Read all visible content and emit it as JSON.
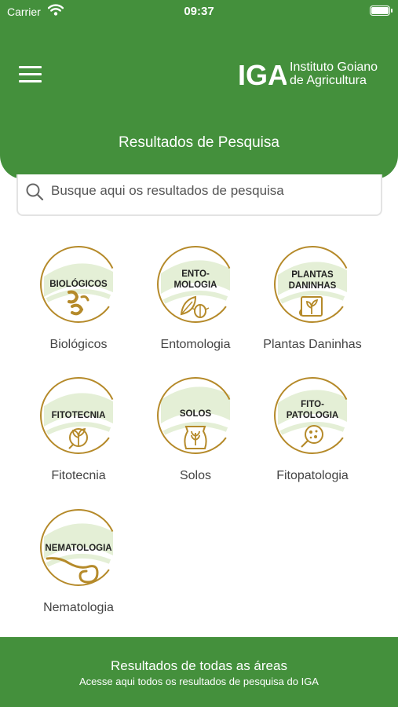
{
  "status": {
    "carrier": "Carrier",
    "time": "09:37"
  },
  "header": {
    "logo_mark": "IGA",
    "logo_line1": "Instituto Goiano",
    "logo_line2": "de Agricultura",
    "title": "Resultados de Pesquisa"
  },
  "search": {
    "placeholder": "Busque aqui os resultados de pesquisa",
    "value": ""
  },
  "categories": [
    {
      "title": "BIOLÓGICOS",
      "label": "Biológicos",
      "icon": "larvae-icon"
    },
    {
      "title": "ENTO-\nMOLOGIA",
      "label": "Entomologia",
      "icon": "beetle-leaf-icon"
    },
    {
      "title": "PLANTAS\nDANINHAS",
      "label": "Plantas Daninhas",
      "icon": "weed-scroll-icon"
    },
    {
      "title": "FITOTECNIA",
      "label": "Fitotecnia",
      "icon": "sprout-globe-icon"
    },
    {
      "title": "SOLOS",
      "label": "Solos",
      "icon": "seed-bag-icon"
    },
    {
      "title": "FITO-\nPATOLOGIA",
      "label": "Fitopatologia",
      "icon": "microbe-icon"
    },
    {
      "title": "NEMATOLOGIA",
      "label": "Nematologia",
      "icon": "nematode-icon"
    }
  ],
  "footer": {
    "title": "Resultados de todas as áreas",
    "subtitle": "Acesse aqui todos os resultados de pesquisa do IGA"
  },
  "colors": {
    "primary": "#44903c",
    "ring": "#b58a2a",
    "wash": "#e4efd6",
    "text": "#444444"
  }
}
